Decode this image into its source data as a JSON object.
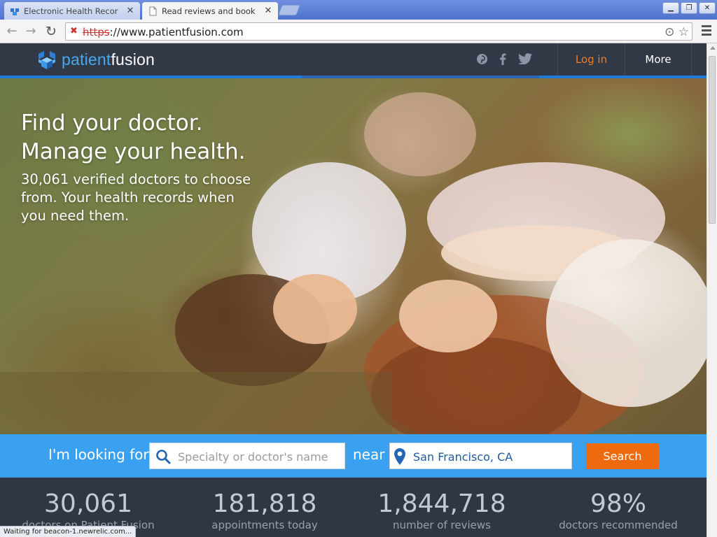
{
  "browser": {
    "tabs": [
      {
        "title": "Electronic Health Recor",
        "active": false
      },
      {
        "title": "Read reviews and book",
        "active": true
      }
    ],
    "url_scheme": "https",
    "url_rest": "://www.patientfusion.com",
    "status_text": "Waiting for beacon-1.newrelic.com..."
  },
  "header": {
    "logo_part1": "patient",
    "logo_part2": "fusion",
    "social": [
      "pinterest-icon",
      "facebook-icon",
      "twitter-icon"
    ],
    "login_label": "Log in",
    "more_label": "More",
    "login_color": "#f47a20"
  },
  "hero": {
    "headline_line1": "Find your doctor.",
    "headline_line2": "Manage your health.",
    "subtext": "30,061 verified doctors to choose from. Your health records when you need them."
  },
  "search": {
    "looking_for_label": "I'm looking for",
    "specialty_placeholder": "Specialty or doctor's name",
    "near_label": "near",
    "location_value": "San Francisco, CA",
    "button_label": "Search",
    "bar_color": "#3aa0f0",
    "button_color": "#ef6a0e"
  },
  "stats": [
    {
      "number": "30,061",
      "label": "doctors on Patient Fusion"
    },
    {
      "number": "181,818",
      "label": "appointments today"
    },
    {
      "number": "1,844,718",
      "label": "number of reviews"
    },
    {
      "number": "98%",
      "label": "doctors recommended"
    }
  ]
}
